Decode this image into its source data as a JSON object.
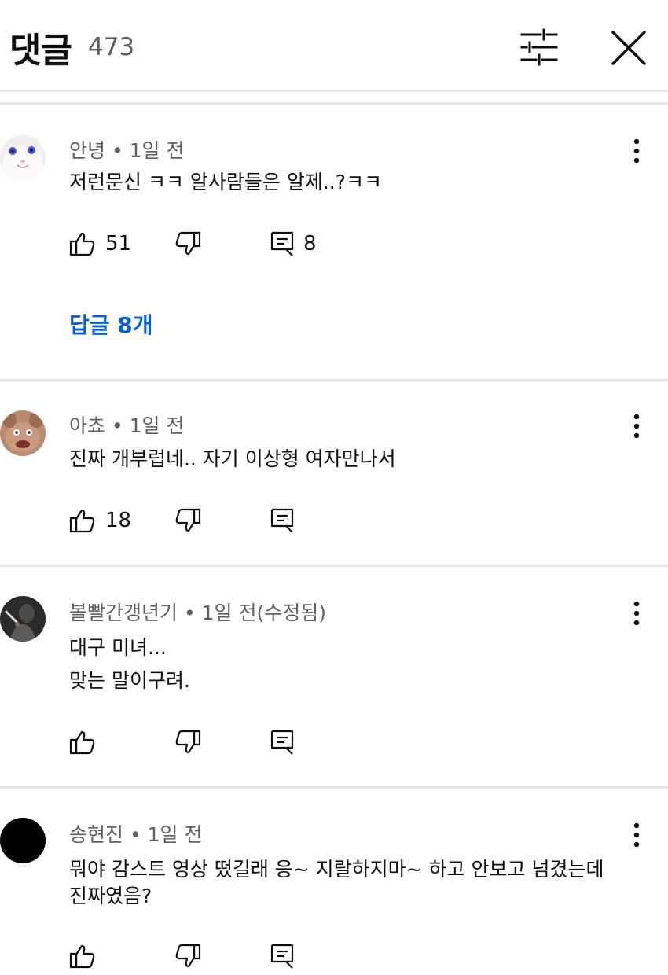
{
  "header": {
    "title": "댓글",
    "count": "473"
  },
  "comments": [
    {
      "author": "안녕",
      "time": "1일 전",
      "lines": [
        "저런문신 ㅋㅋ 알사람들은 알제..?ㅋㅋ"
      ],
      "likes": "51",
      "reply_count": "8",
      "replies_label": "답글 8개"
    },
    {
      "author": "아쵸",
      "time": "1일 전",
      "lines": [
        "진짜 개부럽네.. 자기 이상형 여자만나서"
      ],
      "likes": "18",
      "reply_count": "",
      "replies_label": ""
    },
    {
      "author": "볼빨간갱년기",
      "time": "1일 전(수정됨)",
      "lines": [
        "대구 미녀...",
        "맞는 말이구려."
      ],
      "likes": "",
      "reply_count": "",
      "replies_label": ""
    },
    {
      "author": "송현진",
      "time": "1일 전",
      "lines": [
        "뭐야 감스트 영상 떴길래 응~ 지랄하지마~ 하고 안보고 넘겼는데",
        "진짜였음?"
      ],
      "likes": "",
      "reply_count": "",
      "replies_label": ""
    }
  ],
  "icons": {
    "filter": "sliders-icon",
    "close": "close-icon",
    "more": "more-vert-icon",
    "like": "thumb-up-icon",
    "dislike": "thumb-down-icon",
    "reply": "comment-icon"
  },
  "colors": {
    "link": "#065fd4",
    "meta": "#606060",
    "text": "#0f0f0f",
    "divider": "#e5e5e5"
  }
}
